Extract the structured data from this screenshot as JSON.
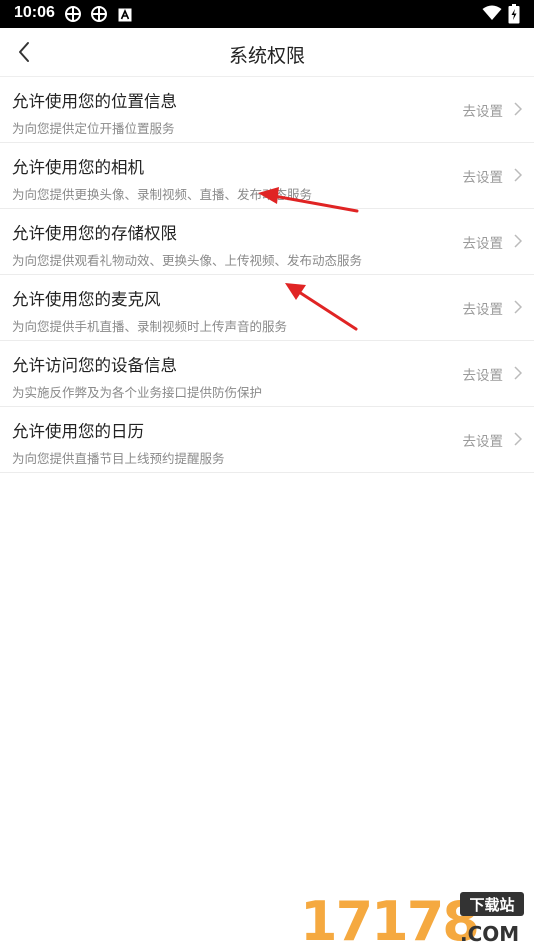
{
  "status_bar": {
    "time": "10:06"
  },
  "header": {
    "title": "系统权限"
  },
  "permissions": [
    {
      "title": "允许使用您的位置信息",
      "desc": "为向您提供定位开播位置服务",
      "action": "去设置"
    },
    {
      "title": "允许使用您的相机",
      "desc": "为向您提供更换头像、录制视频、直播、发布动态服务",
      "action": "去设置"
    },
    {
      "title": "允许使用您的存储权限",
      "desc": "为向您提供观看礼物动效、更换头像、上传视频、发布动态服务",
      "action": "去设置"
    },
    {
      "title": "允许使用您的麦克风",
      "desc": "为向您提供手机直播、录制视频时上传声音的服务",
      "action": "去设置"
    },
    {
      "title": "允许访问您的设备信息",
      "desc": "为实施反作弊及为各个业务接口提供防伤保护",
      "action": "去设置"
    },
    {
      "title": "允许使用您的日历",
      "desc": "为向您提供直播节目上线预约提醒服务",
      "action": "去设置"
    }
  ],
  "watermark": {
    "number": "17178",
    "badge": "下载站",
    "domain": ".COM"
  },
  "colors": {
    "arrow": "#e02424",
    "watermark_orange": "#f39a1e"
  }
}
